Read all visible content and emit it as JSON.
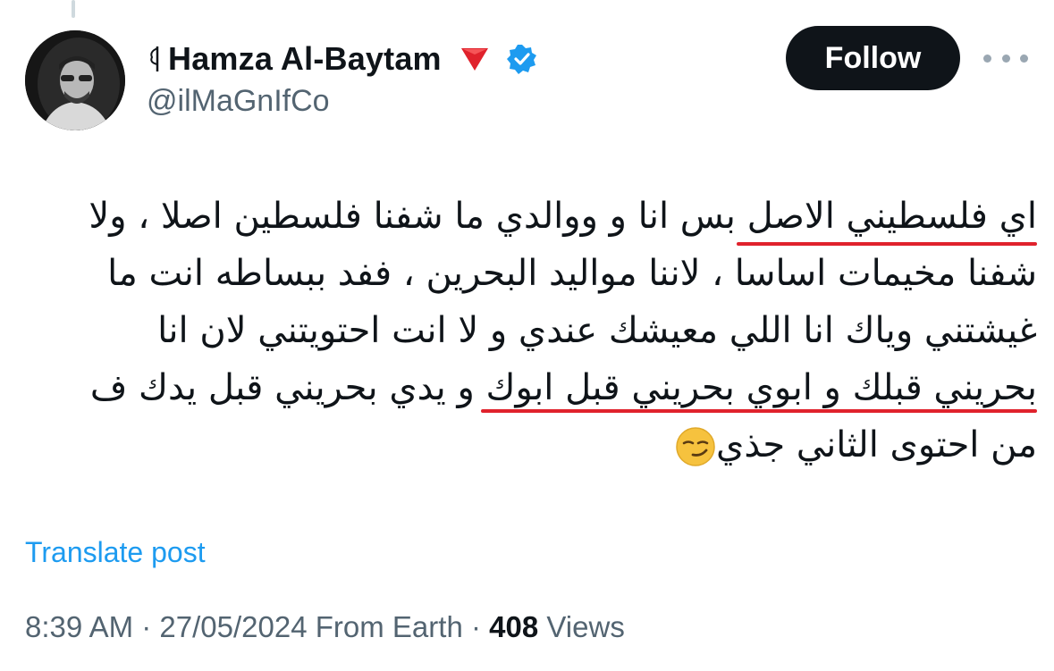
{
  "author": {
    "display_name": "Hamza Al-Baytam",
    "handle": "@ilMaGnIfCo",
    "verified_color": "#1d9bf0",
    "triangle_color": "#e0222c"
  },
  "actions": {
    "follow_label": "Follow"
  },
  "tweet": {
    "lines": [
      "اي فلسطيني الاصل بس انا و ووالدي ما شفنا فلسطين اصلا ، ولا",
      "شفنا مخيمات اساسا ، لاننا مواليد البحرين ، ففد ببساطه انت ما",
      "غيشتني وياك انا اللي معيشك عندي و لا انت احتويتني لان انا",
      "بحريني قبلك و ابوي بحريني قبل ابوك و يدي بحريني قبل يدك ف",
      "من احتوى الثاني جذي"
    ],
    "emoji": "smirking-face",
    "underline_color": "#e0222c"
  },
  "translate_label": "Translate post",
  "meta": {
    "time": "8:39 AM",
    "separator": "·",
    "date": "27/05/2024",
    "source": "From Earth",
    "views_count": "408",
    "views_label": "Views"
  }
}
